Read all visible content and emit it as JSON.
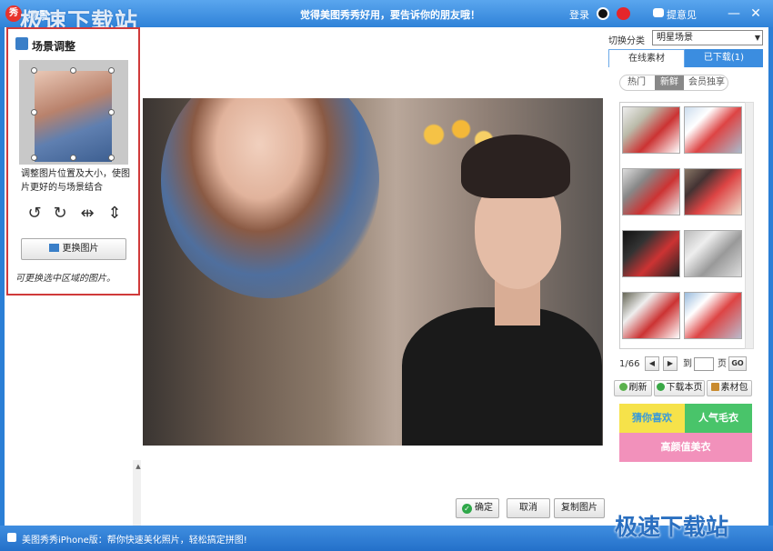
{
  "titlebar": {
    "logo_text": "秀",
    "title": "场景",
    "watermark": "极速下载站",
    "slogan": "觉得美图秀秀好用，要告诉你的朋友哦！",
    "login": "登录",
    "feedback": "提意见",
    "minimize_glyph": "—",
    "close_glyph": "✕"
  },
  "left_panel": {
    "heading": "场景调整",
    "description": "调整图片位置及大小，使图片更好的与场景结合",
    "tools": {
      "rotate_left": "↺",
      "rotate_right": "↻",
      "flip_horizontal": "⇹",
      "flip_vertical": "⇕"
    },
    "change_image_button": "更换图片",
    "hint": "可更换选中区域的图片。"
  },
  "canvas": {
    "ok_button": "确定",
    "ok_icon": "✓",
    "cancel_button": "取消",
    "copy_button": "复制图片",
    "scroll_up": "▲",
    "scroll_down": "▼"
  },
  "right_panel": {
    "category_label": "切换分类",
    "category_value": "明星场景",
    "category_arrow": "▼",
    "tabs": {
      "online": "在线素材",
      "downloaded": "已下载(1)"
    },
    "subtabs": {
      "hot": "热门",
      "new": "新鲜",
      "vip": "会员独享"
    },
    "pager": {
      "page": "1/66",
      "prev": "◀",
      "next": "▶",
      "to": "到",
      "input_value": "",
      "unit": "页",
      "go": "GO"
    },
    "actions": {
      "refresh": "刷新",
      "download_page": "下载本页",
      "material_pack": "素材包"
    },
    "banners": {
      "guess_like": "猜你喜欢",
      "popular_outfit": "人气毛衣",
      "beauty_outfit": "高颜值美衣"
    },
    "colors": {
      "tab_active": "#3b8de0",
      "banner_yellow": "#f6e24a",
      "banner_green": "#49c46a",
      "banner_pink": "#f291bb"
    }
  },
  "statusbar": {
    "text": "美图秀秀iPhone版：帮你快速美化照片，轻松搞定拼图!",
    "watermark": "极速下载站"
  }
}
